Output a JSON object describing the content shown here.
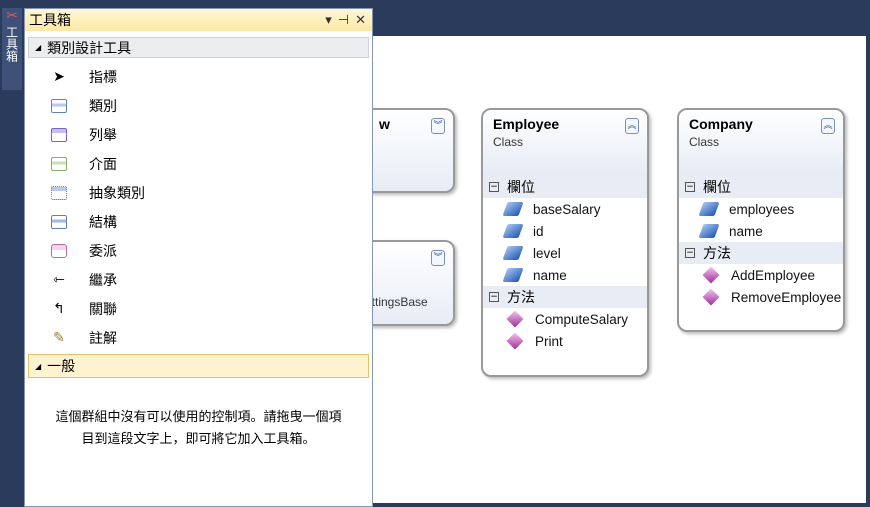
{
  "sidebar_tab": {
    "label": "工具箱",
    "icon": "tools-icon"
  },
  "toolbox": {
    "title": "工具箱",
    "groups": [
      {
        "label": "類別設計工具",
        "expanded": true,
        "items": [
          {
            "label": "指標",
            "icon": "pointer-icon"
          },
          {
            "label": "類別",
            "icon": "class-icon"
          },
          {
            "label": "列舉",
            "icon": "enum-icon"
          },
          {
            "label": "介面",
            "icon": "interface-icon"
          },
          {
            "label": "抽象類別",
            "icon": "abstract-class-icon"
          },
          {
            "label": "結構",
            "icon": "struct-icon"
          },
          {
            "label": "委派",
            "icon": "delegate-icon"
          },
          {
            "label": "繼承",
            "icon": "inheritance-icon"
          },
          {
            "label": "關聯",
            "icon": "association-icon"
          },
          {
            "label": "註解",
            "icon": "comment-icon"
          }
        ]
      },
      {
        "label": "一般",
        "expanded": true
      }
    ],
    "empty_message_line1": "這個群組中沒有可以使用的控制項。請拖曳一個項",
    "empty_message_line2": "目到這段文字上，即可將它加入工具箱。"
  },
  "diagram": {
    "partial1": {
      "name": "w"
    },
    "partial2": {
      "base": "ettingsBase"
    },
    "employee": {
      "name": "Employee",
      "stereotype": "Class",
      "fields_label": "欄位",
      "fields": [
        "baseSalary",
        "id",
        "level",
        "name"
      ],
      "methods_label": "方法",
      "methods": [
        "ComputeSalary",
        "Print"
      ]
    },
    "company": {
      "name": "Company",
      "stereotype": "Class",
      "fields_label": "欄位",
      "fields": [
        "employees",
        "name"
      ],
      "methods_label": "方法",
      "methods": [
        "AddEmployee",
        "RemoveEmployee"
      ]
    }
  },
  "colors": {
    "frame": "#2b3b5c",
    "title_bar": "#fce8a5",
    "selected_group": "#fdf3d0"
  }
}
